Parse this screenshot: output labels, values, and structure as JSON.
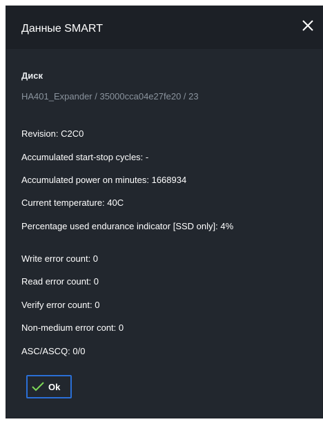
{
  "dialog": {
    "title": "Данные SMART",
    "close_icon": "close-icon"
  },
  "disk": {
    "label": "Диск",
    "path": "HA401_Expander / 35000cca04e27fe20 / 23"
  },
  "info": {
    "revision": "Revision: C2C0",
    "start_stop": "Accumulated start-stop cycles: -",
    "power_on": "Accumulated power on minutes: 1668934",
    "temperature": "Current temperature: 40C",
    "endurance": "Percentage used endurance indicator [SSD only]: 4%"
  },
  "errors": {
    "write": "Write error count: 0",
    "read": "Read error count: 0",
    "verify": "Verify error count: 0",
    "non_medium": "Non-medium error cont: 0",
    "asc": "ASC/ASCQ: 0/0"
  },
  "buttons": {
    "ok_label": "Ok",
    "ok_icon": "checkmark-icon"
  },
  "colors": {
    "dialog_bg": "#22272e",
    "titlebar_bg": "#1c2026",
    "accent": "#2a6fd6",
    "check": "#7ed957",
    "muted_text": "#8a939d"
  }
}
